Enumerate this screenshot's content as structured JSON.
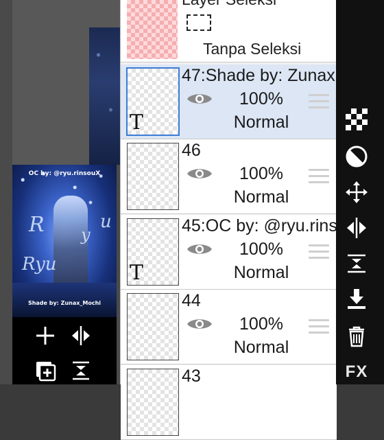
{
  "canvas": {
    "preview_credit_top": "OC by: @ryu.rinsouX",
    "preview_credit_bottom": "Shade by: Zunax_Mochi",
    "preview_script": [
      "R",
      "y",
      "u",
      "Ryu"
    ]
  },
  "left_tools": [
    {
      "icon": "plus-icon"
    },
    {
      "icon": "flip-horizontal-icon"
    },
    {
      "icon": "add-layer-icon"
    },
    {
      "icon": "merge-down-icon"
    }
  ],
  "selection_layer": {
    "name": "Layer Seleksi",
    "status": "Tanpa Seleksi"
  },
  "layers": [
    {
      "name": "47:Shade by: Zunax",
      "opacity": "100%",
      "blend": "Normal",
      "selected": true,
      "text_layer": true
    },
    {
      "name": "46",
      "opacity": "100%",
      "blend": "Normal",
      "selected": false,
      "text_layer": false
    },
    {
      "name": "45:OC by: @ryu.rins",
      "opacity": "100%",
      "blend": "Normal",
      "selected": false,
      "text_layer": true
    },
    {
      "name": "44",
      "opacity": "100%",
      "blend": "Normal",
      "selected": false,
      "text_layer": false
    },
    {
      "name": "43",
      "opacity": "",
      "blend": "",
      "selected": false,
      "text_layer": false
    }
  ],
  "right_tools": [
    {
      "icon": "transparency-lock-icon"
    },
    {
      "icon": "clipping-icon"
    },
    {
      "icon": "move-icon"
    },
    {
      "icon": "flip-horizontal-icon"
    },
    {
      "icon": "merge-down-icon"
    },
    {
      "icon": "download-icon"
    },
    {
      "icon": "trash-icon"
    }
  ],
  "fx_label": "FX",
  "colors": {
    "selected_row": "#dce6f5",
    "selected_border": "#3a7bd5",
    "panel_bg": "#f1f1f1",
    "toolbar_bg": "#111111"
  }
}
